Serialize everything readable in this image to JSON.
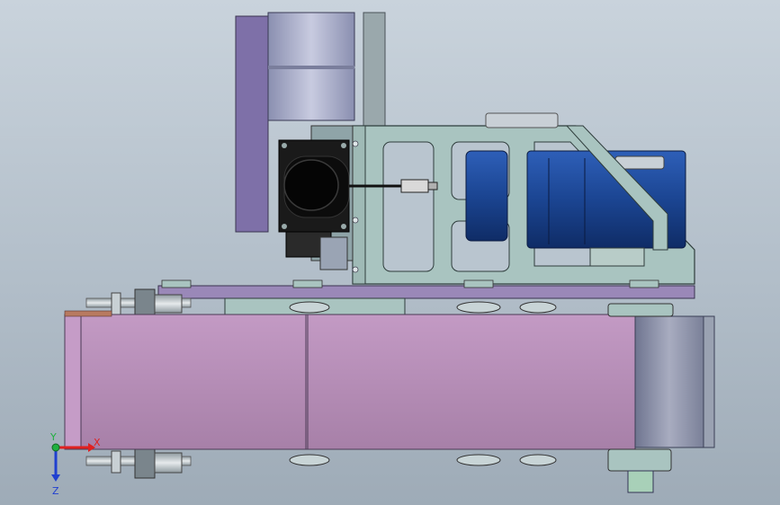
{
  "viewport": {
    "background_top": "#c9d3dc",
    "background_bottom": "#9eabb7"
  },
  "triad": {
    "x_label": "X",
    "y_label": "Y",
    "z_label": "Z",
    "x_color": "#e02020",
    "y_color": "#20b040",
    "z_color": "#2040d0"
  },
  "model": {
    "components": [
      "vertical-roller-assembly",
      "camera-module",
      "cable-connector",
      "mounting-frame",
      "drive-motor",
      "top-plate",
      "conveyor-belt",
      "end-roller",
      "shaft-couplings",
      "roller-bearings"
    ],
    "colors": {
      "belt": "#b88cb8",
      "plate": "#9a88b8",
      "frame": "#a9c4c0",
      "motor": "#1f4a9a",
      "roller": "#a6a8c8",
      "camera": "#1a1a1a",
      "shaft": "#c8d0d4"
    }
  }
}
